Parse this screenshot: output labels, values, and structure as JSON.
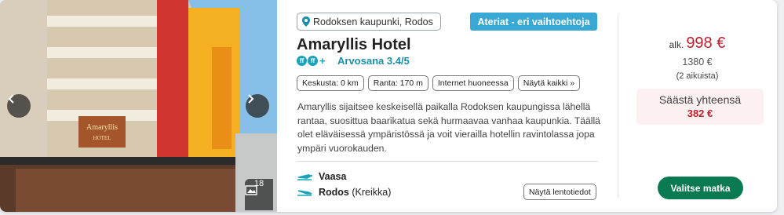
{
  "photo": {
    "image_count": "18"
  },
  "location": {
    "label": "Rodoksen kaupunki, Rodos"
  },
  "meal_badge": "Ateriat - eri vaihtoehtoja",
  "hotel": {
    "name": "Amaryllis Hotel",
    "class_icon_label": "ff",
    "rating_label": "Arvosana 3.4/5",
    "sign_text_1": "Amaryllis",
    "sign_text_2": "HOTEL"
  },
  "chips": [
    "Keskusta: 0 km",
    "Ranta: 170 m",
    "Internet huoneessa",
    "Näytä kaikki »"
  ],
  "description": "Amaryllis sijaitsee keskeisellä paikalla Rodoksen kaupungissa lähellä rantaa, suosittua baarikatua sekä hurmaavaa vanhaa kaupunkia. Täällä olet eläväisessä ympäristössä ja voit vierailla hotellin ravintolassa jopa ympäri vuorokauden.",
  "flights": {
    "departure": "Vaasa",
    "arrival_city": "Rodos",
    "arrival_region": "(Kreikka)",
    "info_button": "Näytä lentotiedot"
  },
  "price": {
    "prefix": "alk.",
    "current": "998 €",
    "original": "1380 €",
    "people": "(2 aikuista)",
    "save_label": "Säästä yhteensä",
    "save_amount": "382 €"
  },
  "cta": "Valitse matka",
  "colors": {
    "accent_red": "#c0202f",
    "badge_blue": "#3aa8d4",
    "cta_green": "#0a7a52",
    "teal": "#1aa3b8"
  }
}
